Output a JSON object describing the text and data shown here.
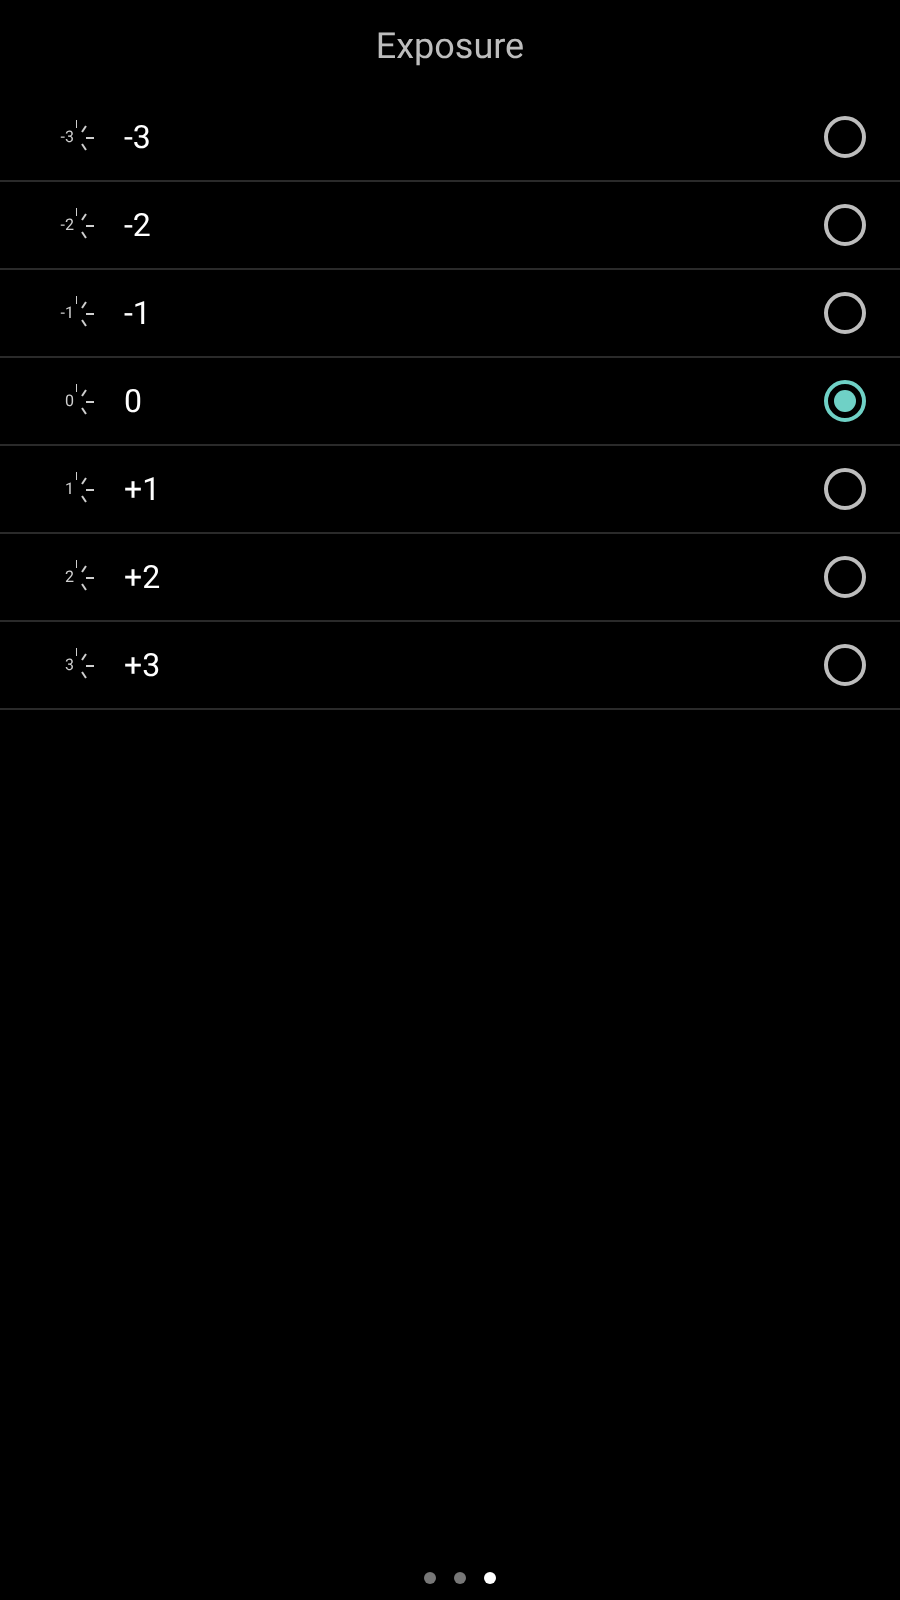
{
  "title": "Exposure",
  "options": [
    {
      "icon_label": "-3",
      "label": "-3",
      "selected": false
    },
    {
      "icon_label": "-2",
      "label": "-2",
      "selected": false
    },
    {
      "icon_label": "-1",
      "label": "-1",
      "selected": false
    },
    {
      "icon_label": "0",
      "label": "0",
      "selected": true
    },
    {
      "icon_label": "1",
      "label": "+1",
      "selected": false
    },
    {
      "icon_label": "2",
      "label": "+2",
      "selected": false
    },
    {
      "icon_label": "3",
      "label": "+3",
      "selected": false
    }
  ],
  "page_dots": [
    {
      "selected": false
    },
    {
      "selected": false
    },
    {
      "selected": true
    }
  ]
}
